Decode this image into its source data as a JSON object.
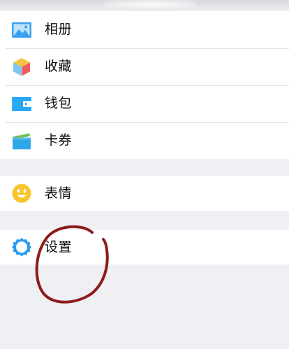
{
  "menu": {
    "items": [
      {
        "label": "相册",
        "icon": "album-icon",
        "color": "#3aa1f0"
      },
      {
        "label": "收藏",
        "icon": "favorites-cube-icon",
        "color": "#f5c242"
      },
      {
        "label": "钱包",
        "icon": "wallet-icon",
        "color": "#29a9f2"
      },
      {
        "label": "卡券",
        "icon": "card-coupon-icon",
        "color": "#2fa8e8"
      }
    ]
  },
  "stickers": {
    "label": "表情",
    "icon": "smiley-icon",
    "color": "#f7c52d"
  },
  "settings": {
    "label": "设置",
    "icon": "gear-icon",
    "color": "#2b9cf0"
  },
  "annotation": {
    "shape": "hand-drawn-circle",
    "color": "#8e1b1b"
  }
}
